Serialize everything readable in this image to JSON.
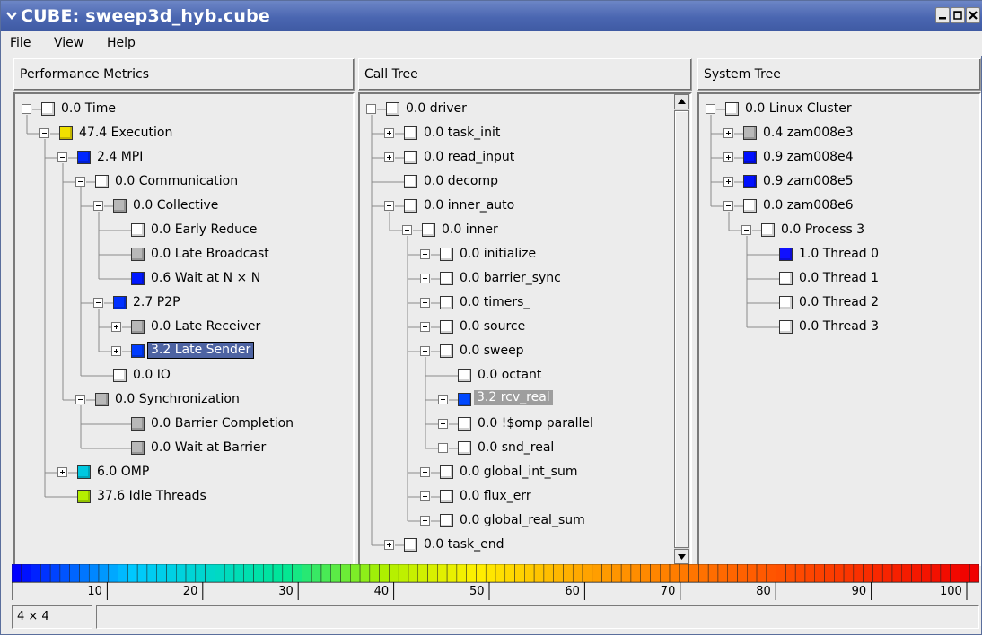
{
  "window": {
    "title": "CUBE: sweep3d_hyb.cube"
  },
  "menu": {
    "file": "File",
    "view": "View",
    "help": "Help"
  },
  "metrics": {
    "header": "Performance Metrics",
    "nodes": [
      {
        "label": "0.0 Time",
        "depth": 0,
        "toggle": "minus",
        "color": "#ffffff"
      },
      {
        "label": "47.4 Execution",
        "depth": 1,
        "toggle": "minus",
        "color": "#f0e000"
      },
      {
        "label": "2.4 MPI",
        "depth": 2,
        "toggle": "minus",
        "color": "#0026ff"
      },
      {
        "label": "0.0 Communication",
        "depth": 3,
        "toggle": "minus",
        "color": "#ffffff"
      },
      {
        "label": "0.0 Collective",
        "depth": 4,
        "toggle": "minus",
        "color": "#b8b8b8"
      },
      {
        "label": "0.0 Early Reduce",
        "depth": 5,
        "toggle": "none",
        "color": "#ffffff"
      },
      {
        "label": "0.0 Late Broadcast",
        "depth": 5,
        "toggle": "none",
        "color": "#b8b8b8"
      },
      {
        "label": "0.6 Wait at N × N",
        "depth": 5,
        "toggle": "none",
        "color": "#0018ff"
      },
      {
        "label": "2.7 P2P",
        "depth": 4,
        "toggle": "minus",
        "color": "#0030ff"
      },
      {
        "label": "0.0 Late Receiver",
        "depth": 5,
        "toggle": "plus",
        "color": "#b8b8b8"
      },
      {
        "label": "3.2 Late Sender",
        "depth": 5,
        "toggle": "plus",
        "color": "#003cff",
        "selected": "dark"
      },
      {
        "label": "0.0 IO",
        "depth": 4,
        "toggle": "none",
        "color": "#ffffff"
      },
      {
        "label": "0.0 Synchronization",
        "depth": 3,
        "toggle": "minus",
        "color": "#b8b8b8"
      },
      {
        "label": "0.0 Barrier Completion",
        "depth": 5,
        "toggle": "none",
        "color": "#b8b8b8"
      },
      {
        "label": "0.0 Wait at Barrier",
        "depth": 5,
        "toggle": "none",
        "color": "#b8b8b8"
      },
      {
        "label": "6.0 OMP",
        "depth": 2,
        "toggle": "plus",
        "color": "#00c8e0"
      },
      {
        "label": "37.6 Idle Threads",
        "depth": 2,
        "toggle": "none",
        "color": "#b4f000"
      }
    ]
  },
  "calltree": {
    "header": "Call Tree",
    "nodes": [
      {
        "label": "0.0 driver",
        "depth": 0,
        "toggle": "minus",
        "color": "#ffffff"
      },
      {
        "label": "0.0 task_init",
        "depth": 1,
        "toggle": "plus",
        "color": "#ffffff"
      },
      {
        "label": "0.0 read_input",
        "depth": 1,
        "toggle": "plus",
        "color": "#ffffff"
      },
      {
        "label": "0.0 decomp",
        "depth": 1,
        "toggle": "none",
        "color": "#ffffff"
      },
      {
        "label": "0.0 inner_auto",
        "depth": 1,
        "toggle": "minus",
        "color": "#ffffff"
      },
      {
        "label": "0.0 inner",
        "depth": 2,
        "toggle": "minus",
        "color": "#ffffff"
      },
      {
        "label": "0.0 initialize",
        "depth": 3,
        "toggle": "plus",
        "color": "#ffffff"
      },
      {
        "label": "0.0 barrier_sync",
        "depth": 3,
        "toggle": "plus",
        "color": "#ffffff"
      },
      {
        "label": "0.0 timers_",
        "depth": 3,
        "toggle": "plus",
        "color": "#ffffff"
      },
      {
        "label": "0.0 source",
        "depth": 3,
        "toggle": "plus",
        "color": "#ffffff"
      },
      {
        "label": "0.0 sweep",
        "depth": 3,
        "toggle": "minus",
        "color": "#ffffff"
      },
      {
        "label": "0.0 octant",
        "depth": 4,
        "toggle": "none",
        "color": "#ffffff"
      },
      {
        "label": "3.2 rcv_real",
        "depth": 4,
        "toggle": "plus",
        "color": "#0048ff",
        "selected": "gray"
      },
      {
        "label": "0.0 !$omp parallel",
        "depth": 4,
        "toggle": "plus",
        "color": "#ffffff"
      },
      {
        "label": "0.0 snd_real",
        "depth": 4,
        "toggle": "plus",
        "color": "#ffffff"
      },
      {
        "label": "0.0 global_int_sum",
        "depth": 3,
        "toggle": "plus",
        "color": "#ffffff"
      },
      {
        "label": "0.0 flux_err",
        "depth": 3,
        "toggle": "plus",
        "color": "#ffffff"
      },
      {
        "label": "0.0 global_real_sum",
        "depth": 3,
        "toggle": "plus",
        "color": "#ffffff"
      },
      {
        "label": "0.0 task_end",
        "depth": 1,
        "toggle": "plus",
        "color": "#ffffff"
      }
    ]
  },
  "systemtree": {
    "header": "System Tree",
    "nodes": [
      {
        "label": "0.0 Linux Cluster",
        "depth": 0,
        "toggle": "minus",
        "color": "#ffffff"
      },
      {
        "label": "0.4 zam008e3",
        "depth": 1,
        "toggle": "plus",
        "color": "#b8b8b8"
      },
      {
        "label": "0.9 zam008e4",
        "depth": 1,
        "toggle": "plus",
        "color": "#0010ff"
      },
      {
        "label": "0.9 zam008e5",
        "depth": 1,
        "toggle": "plus",
        "color": "#0010ff"
      },
      {
        "label": "0.0 zam008e6",
        "depth": 1,
        "toggle": "minus",
        "color": "#ffffff"
      },
      {
        "label": "0.0 Process 3",
        "depth": 2,
        "toggle": "minus",
        "color": "#ffffff"
      },
      {
        "label": "1.0 Thread 0",
        "depth": 3,
        "toggle": "none",
        "color": "#1010ff"
      },
      {
        "label": "0.0 Thread 1",
        "depth": 3,
        "toggle": "none",
        "color": "#ffffff"
      },
      {
        "label": "0.0 Thread 2",
        "depth": 3,
        "toggle": "none",
        "color": "#ffffff"
      },
      {
        "label": "0.0 Thread 3",
        "depth": 3,
        "toggle": "none",
        "color": "#ffffff"
      }
    ]
  },
  "scale": {
    "ticks": [
      "10",
      "20",
      "30",
      "40",
      "50",
      "60",
      "70",
      "80",
      "90",
      "100"
    ]
  },
  "status": {
    "left": "4 × 4",
    "right": ""
  }
}
